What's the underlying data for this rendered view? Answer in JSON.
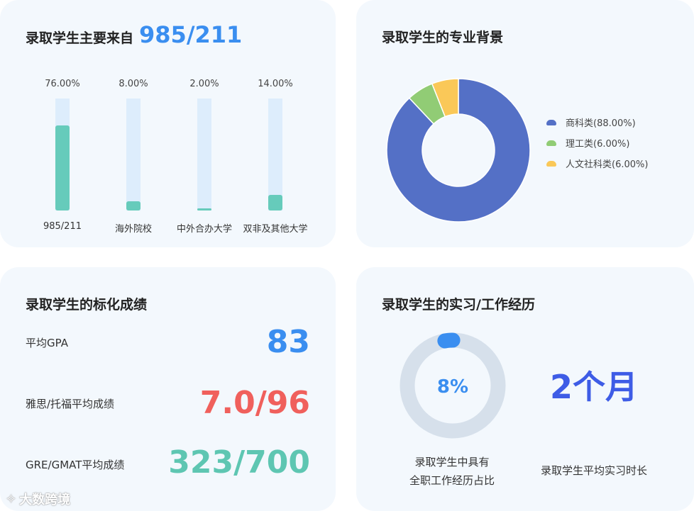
{
  "card1": {
    "title": "录取学生主要来自",
    "highlight": "985/211",
    "chart_data": {
      "type": "bar",
      "categories": [
        "985/211",
        "海外院校",
        "中外合办大学",
        "双非及其他大学"
      ],
      "values": [
        76.0,
        8.0,
        2.0,
        14.0
      ],
      "value_labels": [
        "76.00%",
        "8.00%",
        "2.00%",
        "14.00%"
      ],
      "ylim": [
        0,
        100
      ],
      "colors": {
        "fill": "#66cbbb",
        "track": "#ddedfc"
      }
    }
  },
  "card2": {
    "title": "录取学生的专业背景",
    "chart_data": {
      "type": "pie",
      "donut": true,
      "categories": [
        "商科类",
        "理工类",
        "人文社科类"
      ],
      "values": [
        88.0,
        6.0,
        6.0
      ],
      "legend_labels": [
        "商科类(88.00%)",
        "理工类(6.00%)",
        "人文社科类(6.00%)"
      ],
      "colors": [
        "#5470c6",
        "#91cc75",
        "#fac858"
      ],
      "legend_position": "right"
    }
  },
  "card3": {
    "title": "录取学生的标化成绩",
    "rows": [
      {
        "label": "平均GPA",
        "value": "83",
        "color": "#3a8ef0"
      },
      {
        "label": "雅思/托福平均成绩",
        "value": "7.0/96",
        "color": "#f0605c"
      },
      {
        "label": "GRE/GMAT平均成绩",
        "value": "323/700",
        "color": "#5ec6b2"
      }
    ]
  },
  "card4": {
    "title": "录取学生的实习/工作经历",
    "ring": {
      "percent": 8,
      "label": "8%",
      "track_color": "#d6e0eb",
      "fill_color": "#3a8ef0"
    },
    "ring_caption_line1": "录取学生中具有",
    "ring_caption_line2": "全职工作经历占比",
    "duration": "2个月",
    "duration_color": "#3e5ce6",
    "duration_caption": "录取学生平均实习时长"
  },
  "watermark": "大数跨境"
}
